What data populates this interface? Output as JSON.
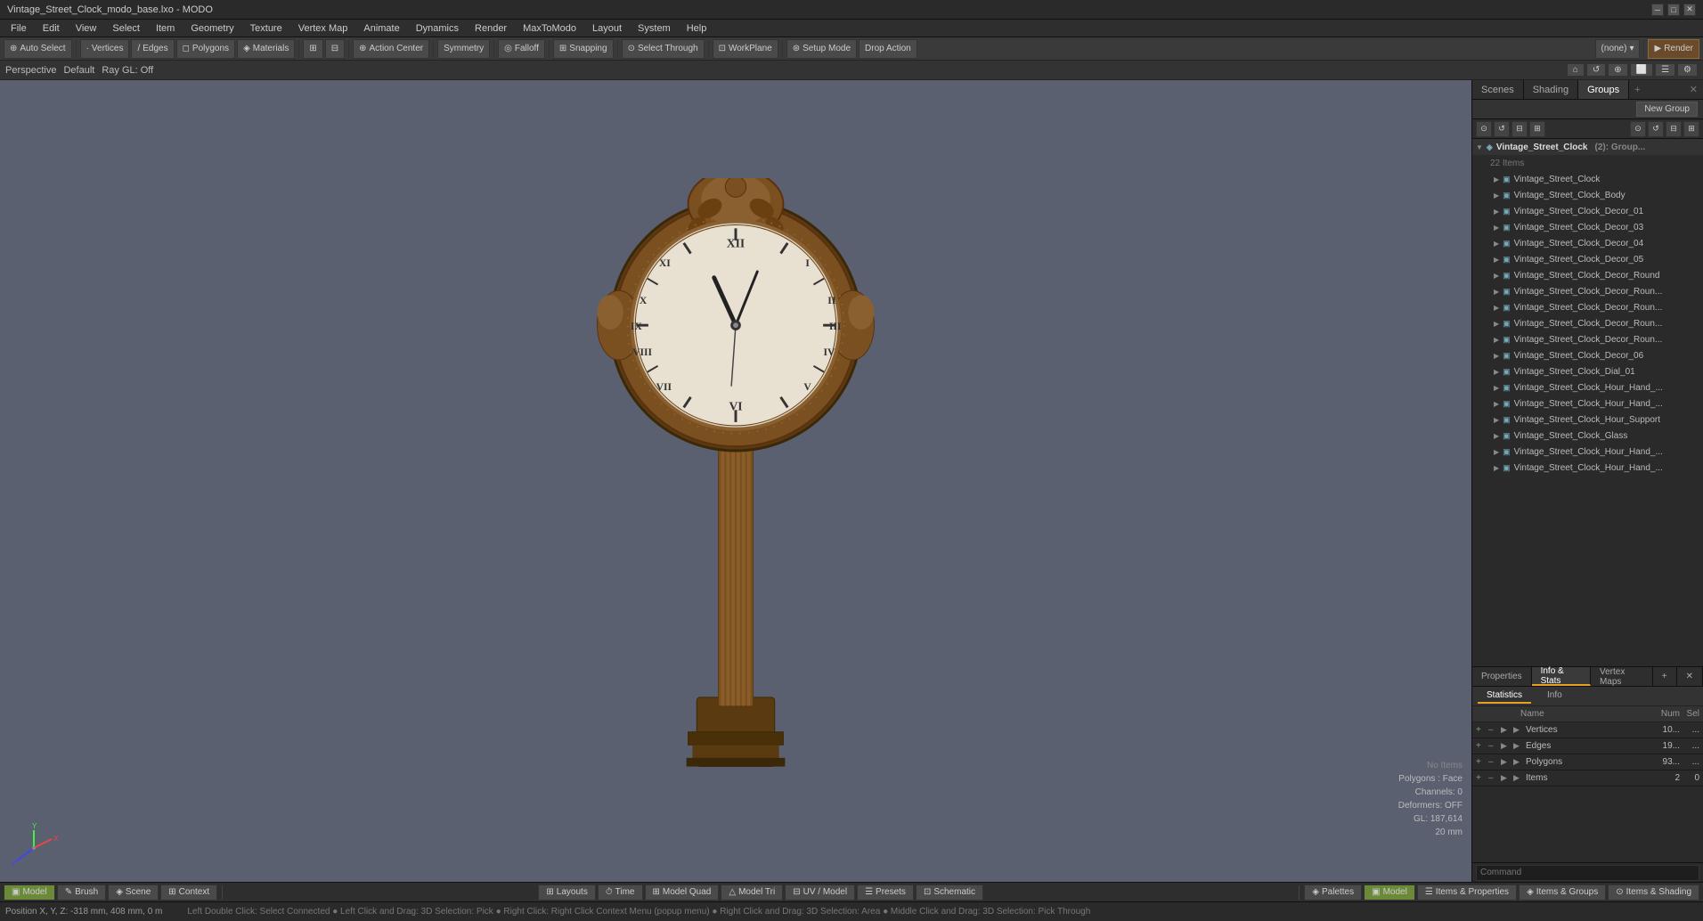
{
  "window": {
    "title": "Vintage_Street_Clock_modo_base.lxo - MODO"
  },
  "menu": {
    "items": [
      "File",
      "Edit",
      "View",
      "Select",
      "Item",
      "Geometry",
      "Texture",
      "Vertex Map",
      "Animate",
      "Dynamics",
      "Render",
      "MaxToModo",
      "Layout",
      "System",
      "Help"
    ]
  },
  "toolbar": {
    "auto_select": "Auto Select",
    "vertices": "Vertices",
    "edges": "Edges",
    "polygons": "Polygons",
    "materials": "Materials",
    "action_center": "Action Center",
    "symmetry": "Symmetry",
    "falloff": "Falloff",
    "snapping": "Snapping",
    "select_through": "Select Through",
    "workplane": "WorkPlane",
    "setup_mode": "Setup Mode",
    "drop_action": "Drop Action",
    "none_dropdown": "(none)",
    "render": "Render"
  },
  "viewport": {
    "mode": "Perspective",
    "shading": "Default",
    "ray_gl": "Ray GL: Off"
  },
  "viewport_info": {
    "no_items": "No Items",
    "polygons": "Polygons : Face",
    "channels": "Channels: 0",
    "deformers": "Deformers: OFF",
    "gl": "GL: 187,614",
    "mm": "20 mm"
  },
  "status_bar": {
    "position": "Position X, Y, Z:  -318 mm, 408 mm, 0 m",
    "hints": "Left Double Click: Select Connected  ●  Left Click and Drag: 3D Selection: Pick  ●  Right Click: Right Click Context Menu (popup menu)  ●  Right Click and Drag: 3D Selection: Area  ●  Middle Click and Drag: 3D Selection: Pick Through"
  },
  "right_panel": {
    "tabs": [
      "Scenes",
      "Shading",
      "Groups"
    ],
    "active_tab": "Groups",
    "new_group_btn": "New Group",
    "scene_tree": {
      "root": {
        "name": "Vintage_Street_Clock",
        "suffix": "(2): Group...",
        "count": "22 Items",
        "children": [
          "Vintage_Street_Clock",
          "Vintage_Street_Clock_Body",
          "Vintage_Street_Clock_Decor_01",
          "Vintage_Street_Clock_Decor_03",
          "Vintage_Street_Clock_Decor_04",
          "Vintage_Street_Clock_Decor_05",
          "Vintage_Street_Clock_Decor_Round",
          "Vintage_Street_Clock_Decor_Roun...",
          "Vintage_Street_Clock_Decor_Roun...",
          "Vintage_Street_Clock_Decor_Roun...",
          "Vintage_Street_Clock_Decor_Roun...",
          "Vintage_Street_Clock_Decor_06",
          "Vintage_Street_Clock_Dial_01",
          "Vintage_Street_Clock_Hour_Hand_...",
          "Vintage_Street_Clock_Hour_Hand_...",
          "Vintage_Street_Clock_Hour_Support",
          "Vintage_Street_Clock_Glass",
          "Vintage_Street_Clock_Hour_Hand_...",
          "Vintage_Street_Clock_Hour_Hand_..."
        ]
      }
    }
  },
  "prop_panel": {
    "tabs": [
      "Properties",
      "Info & Stats",
      "Vertex Maps"
    ],
    "active_tab": "Info & Stats",
    "add_tab": "+",
    "stats_tabs": [
      "Statistics",
      "Info"
    ],
    "active_stats_tab": "Statistics",
    "columns": {
      "name": "Name",
      "num": "Num",
      "sel": "Sel"
    },
    "stats_rows": [
      {
        "name": "Vertices",
        "num": "10...",
        "sel": "..."
      },
      {
        "name": "Edges",
        "num": "19...",
        "sel": "..."
      },
      {
        "name": "Polygons",
        "num": "93...",
        "sel": "..."
      },
      {
        "name": "Items",
        "num": "2",
        "sel": "0"
      }
    ]
  },
  "bottom_tabs": {
    "items": [
      {
        "label": "Model",
        "active": true
      },
      {
        "label": "Brush",
        "active": false
      },
      {
        "label": "Scene",
        "active": false
      },
      {
        "label": "Context",
        "active": false
      }
    ]
  },
  "bottom_bar_center": {
    "items": [
      {
        "label": "Layouts",
        "active": false
      },
      {
        "label": "Time",
        "active": false
      },
      {
        "label": "Model Quad",
        "active": false
      },
      {
        "label": "Model Tri",
        "active": false
      },
      {
        "label": "UV / Model",
        "active": false
      },
      {
        "label": "Presets",
        "active": false
      },
      {
        "label": "Schematic",
        "active": false
      }
    ]
  },
  "bottom_bar_right": {
    "items": [
      {
        "label": "Palettes",
        "active": false
      },
      {
        "label": "Model",
        "active": true
      },
      {
        "label": "Items & Properties",
        "active": false
      },
      {
        "label": "Items & Groups",
        "active": false
      },
      {
        "label": "Items & Shading",
        "active": false
      }
    ]
  },
  "command_bar": {
    "placeholder": "Command",
    "label": "Command"
  }
}
